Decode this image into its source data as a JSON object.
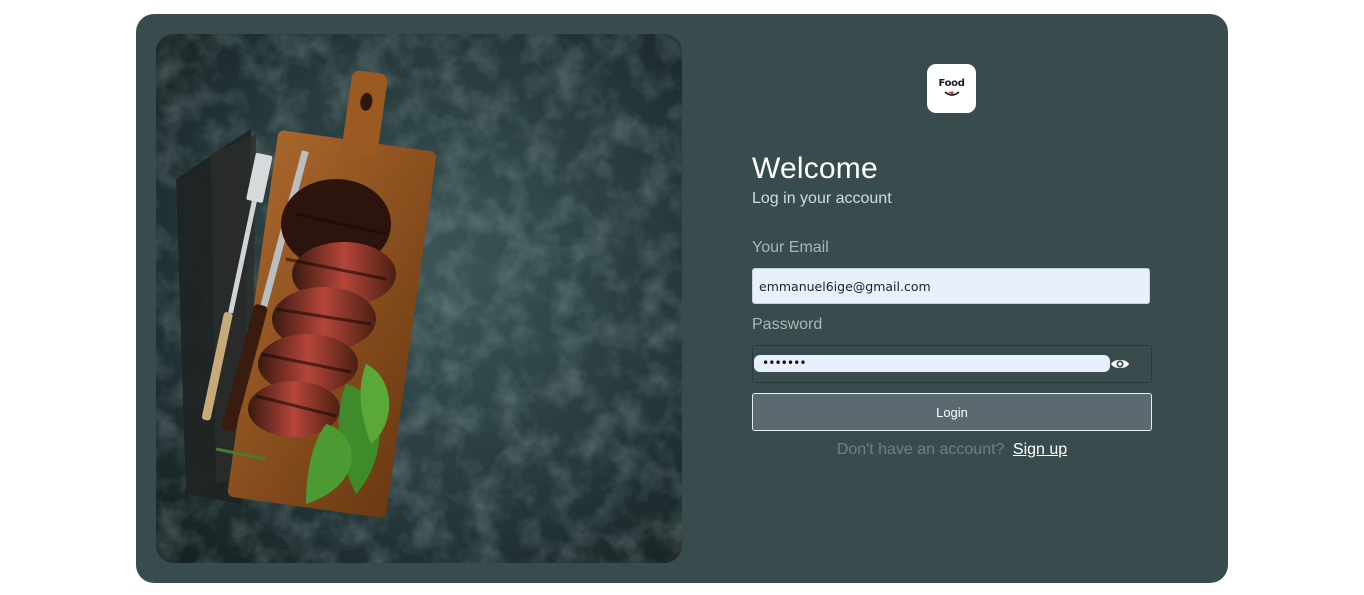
{
  "brand": {
    "logo_text": "Food"
  },
  "login": {
    "title": "Welcome",
    "subtitle": "Log in your account",
    "email_label": "Your Email",
    "email_value": "emmanuel6ige@gmail.com",
    "password_label": "Password",
    "password_masked": "•••••••",
    "login_button": "Login",
    "signup_prompt": "Don't have an account?",
    "signup_link": "Sign up"
  },
  "icons": {
    "show_password": "eye-icon",
    "logo": "food-logo-icon"
  },
  "colors": {
    "card_background": "#384b4d",
    "input_background": "#e8f0fe",
    "login_button_background": "#5a6a70",
    "page_background": "#ffffff"
  }
}
